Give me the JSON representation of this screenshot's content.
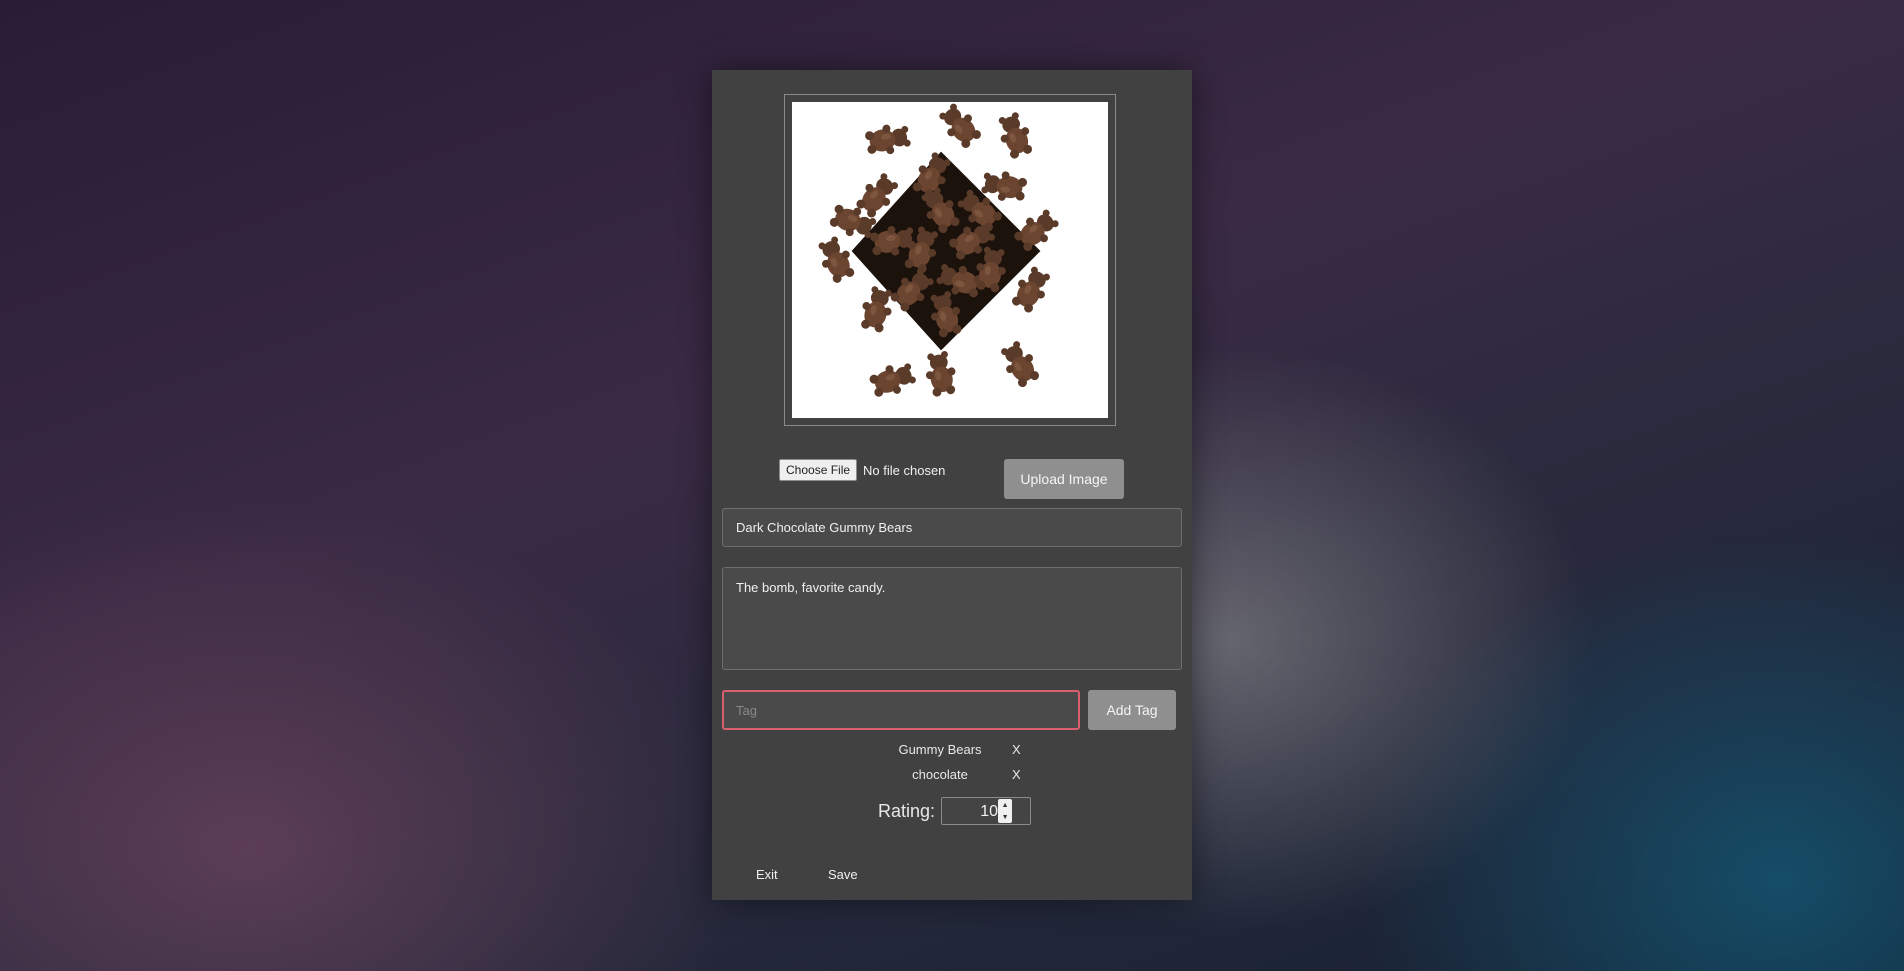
{
  "item": {
    "image_alt": "Dark chocolate gummy bears",
    "file_input": {
      "button_label": "Choose File",
      "status": "No file chosen"
    },
    "upload_label": "Upload Image",
    "name_value": "Dark Chocolate Gummy Bears",
    "description_value": "The bomb, favorite candy.",
    "tag_placeholder": "Tag",
    "add_tag_label": "Add Tag",
    "tags": [
      {
        "name": "Gummy Bears",
        "remove_label": "X"
      },
      {
        "name": "chocolate",
        "remove_label": "X"
      }
    ],
    "rating_label": "Rating:",
    "rating_value": "10"
  },
  "footer": {
    "exit_label": "Exit",
    "save_label": "Save"
  },
  "colors": {
    "dialog_bg": "#414141",
    "button_bg": "#8f8f8f",
    "focus_border": "#d8606e"
  }
}
